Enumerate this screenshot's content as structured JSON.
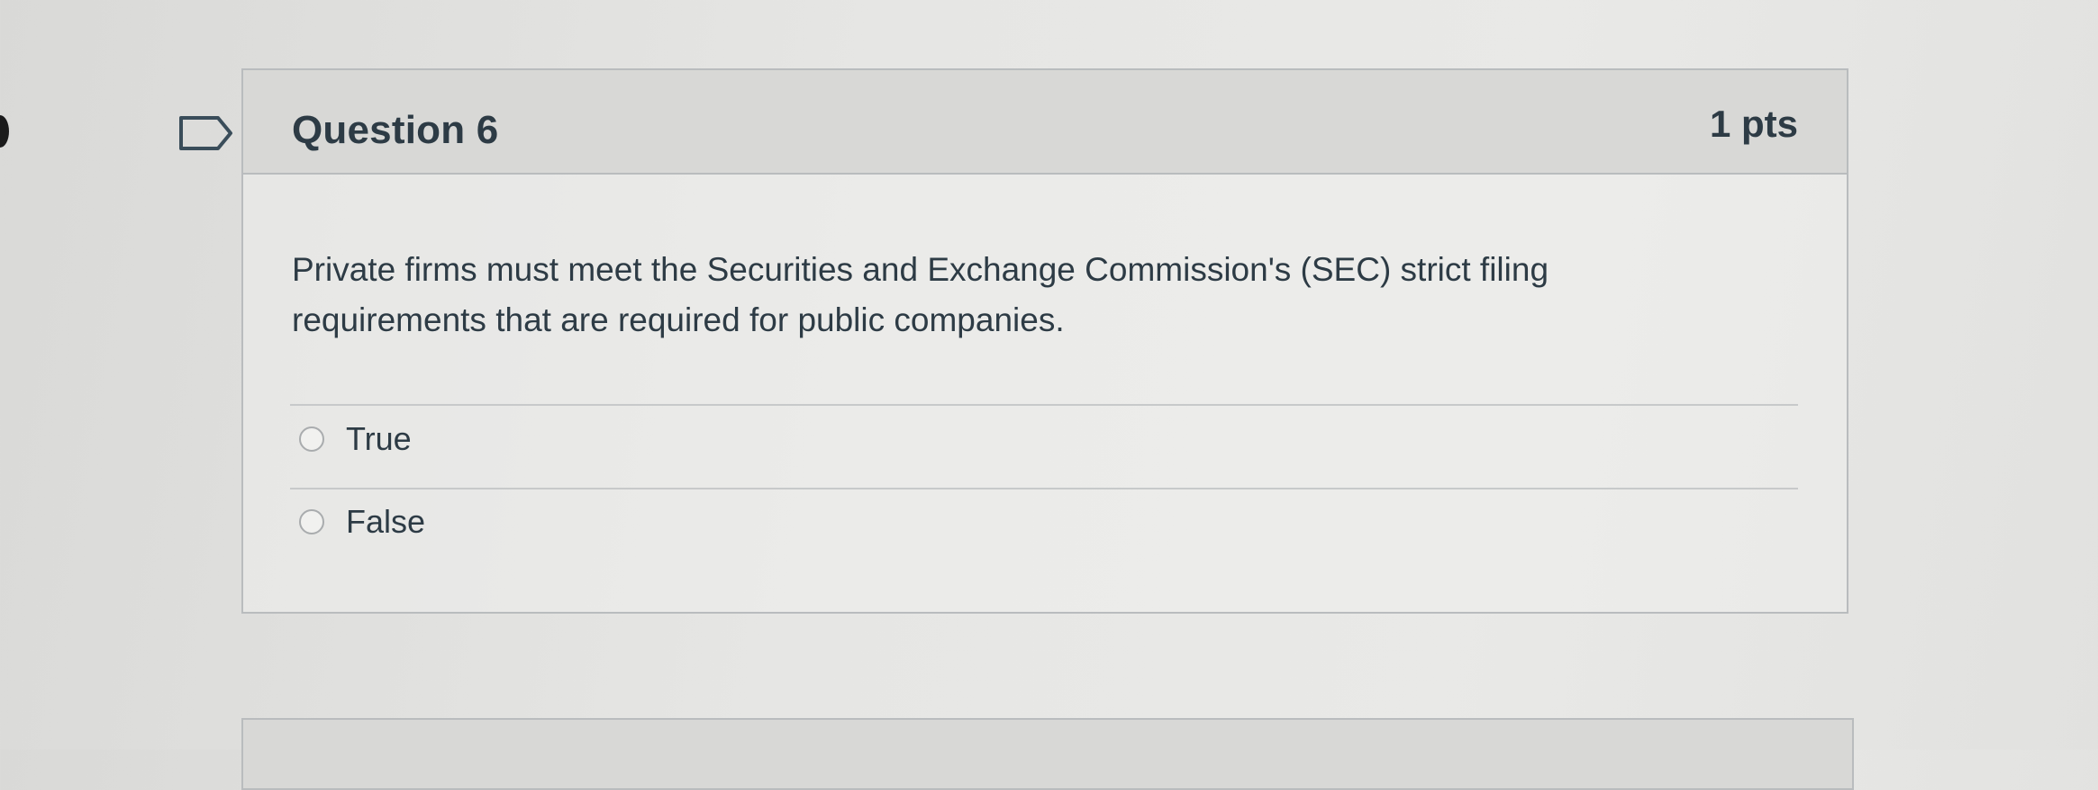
{
  "question": {
    "title": "Question 6",
    "points": "1 pts",
    "text": "Private firms must meet the Securities and Exchange Commission's (SEC) strict filing requirements that are required for public companies.",
    "flag_icon": "flag-outline-icon",
    "answers": [
      {
        "label": "True",
        "icon": "radio-unchecked-icon"
      },
      {
        "label": "False",
        "icon": "radio-unchecked-icon"
      }
    ]
  },
  "colors": {
    "text": "#2d3b45",
    "border": "#b9bcbe",
    "header_bg": "#d8d8d6"
  }
}
